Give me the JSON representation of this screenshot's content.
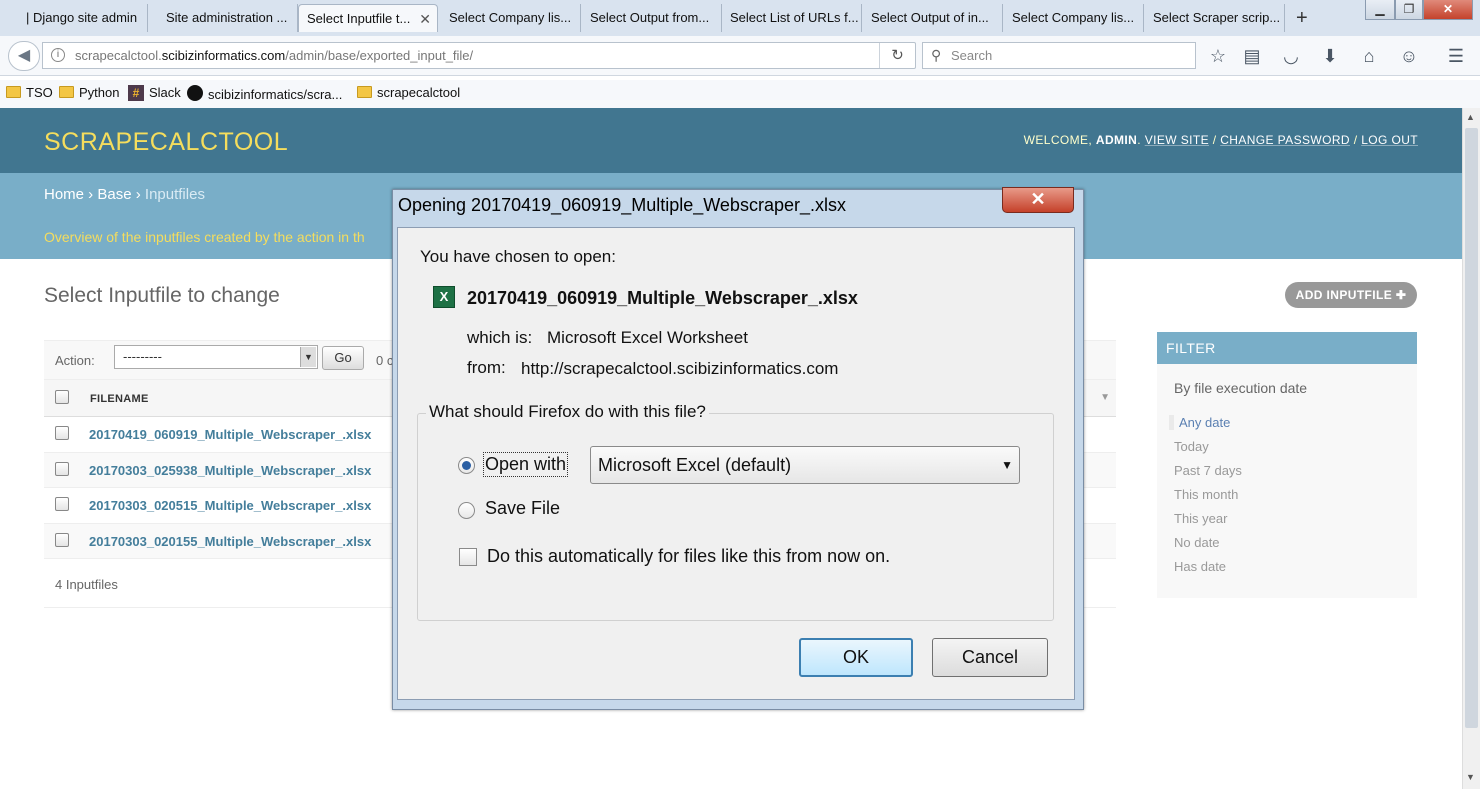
{
  "browser": {
    "tabs": [
      {
        "label": "| Django site admin"
      },
      {
        "label": "Site administration ..."
      },
      {
        "label": "Select Inputfile t..."
      },
      {
        "label": "Select Company lis..."
      },
      {
        "label": "Select Output from..."
      },
      {
        "label": "Select List of URLs f..."
      },
      {
        "label": "Select Output of in..."
      },
      {
        "label": "Select Company lis..."
      },
      {
        "label": "Select Scraper scrip..."
      }
    ],
    "new_tab": "+",
    "close_tab": "✕",
    "url_prefix": "scrapecalctool.",
    "url_domain": "scibizinformatics.com",
    "url_path": "/admin/base/exported_input_file/",
    "search_placeholder": "Search",
    "bookmarks": [
      "TSO",
      "Python",
      "Slack",
      "scibizinformatics/scra...",
      "scrapecalctool"
    ]
  },
  "admin": {
    "brand": "SCRAPECALCTOOL",
    "welcome": "WELCOME, ",
    "username": "ADMIN",
    "view_site": "VIEW SITE",
    "change_password": "CHANGE PASSWORD",
    "log_out": "LOG OUT",
    "breadcrumb_home": "Home",
    "breadcrumb_base": "Base",
    "breadcrumb_current": "Inputfiles",
    "overview": "Overview of the inputfiles created by the action in th",
    "page_title": "Select Inputfile to change",
    "add_button": "ADD INPUTFILE",
    "action_label": "Action:",
    "action_value": "---------",
    "go_label": "Go",
    "selected_count": "0 c",
    "column_header": "FILENAME",
    "rows": [
      "20170419_060919_Multiple_Webscraper_.xlsx",
      "20170303_025938_Multiple_Webscraper_.xlsx",
      "20170303_020515_Multiple_Webscraper_.xlsx",
      "20170303_020155_Multiple_Webscraper_.xlsx"
    ],
    "result_count": "4 Inputfiles",
    "filter": {
      "title": "FILTER",
      "subtitle": "By file execution date",
      "options": [
        "Any date",
        "Today",
        "Past 7 days",
        "This month",
        "This year",
        "No date",
        "Has date"
      ]
    }
  },
  "dialog": {
    "title": "Opening 20170419_060919_Multiple_Webscraper_.xlsx",
    "chosen_label": "You have chosen to open:",
    "filename": "20170419_060919_Multiple_Webscraper_.xlsx",
    "which_is_label": "which is:",
    "which_is_value": "Microsoft Excel Worksheet",
    "from_label": "from:",
    "from_value": "http://scrapecalctool.scibizinformatics.com",
    "question": "What should Firefox do with this file?",
    "open_with_label": "Open with",
    "open_with_app": "Microsoft Excel (default)",
    "save_file_label": "Save File",
    "auto_label": "Do this automatically for files like this from now on.",
    "ok_label": "OK",
    "cancel_label": "Cancel"
  }
}
